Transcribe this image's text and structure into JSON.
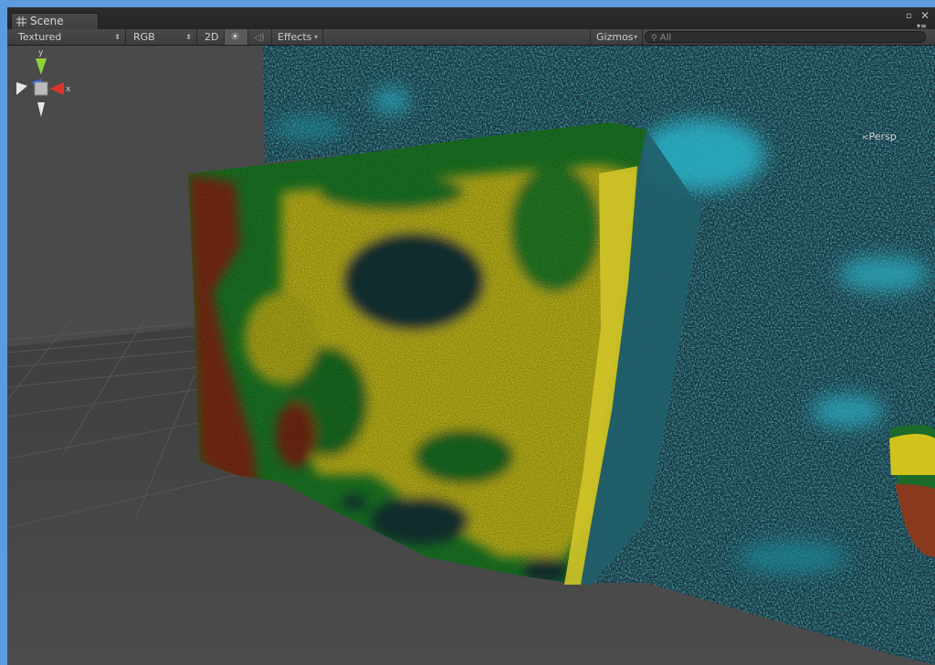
{
  "window": {
    "tab_title": "Scene",
    "tab_icon": "grid-icon",
    "controls": {
      "maximize_icon": "maximize-icon",
      "close_icon": "close-icon",
      "menu_icon": "menu-icon"
    }
  },
  "toolbar": {
    "render_mode": "Textured",
    "color_mode": "RGB",
    "mode_2d": "2D",
    "lighting_icon": "sun-icon",
    "audio_icon": "speaker-icon",
    "effects_label": "Effects",
    "gizmos_label": "Gizmos",
    "search_placeholder": "All"
  },
  "scene_gizmo": {
    "y_label": "y",
    "x_label": "x",
    "projection_label": "Persp"
  },
  "colors": {
    "accent_border": "#5d9be0",
    "axis_y": "#8fd13a",
    "axis_x": "#d8352b",
    "axis_z": "#3b66d8"
  }
}
